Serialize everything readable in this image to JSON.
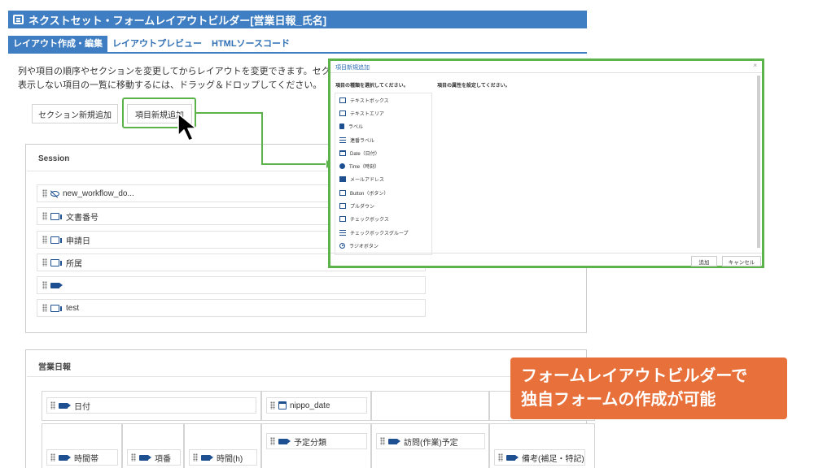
{
  "app": {
    "title": "ネクストセット・フォームレイアウトビルダー[営業日報_氏名]"
  },
  "tabs": [
    {
      "label": "レイアウト作成・編集",
      "active": true
    },
    {
      "label": "レイアウトプレビュー",
      "active": false
    },
    {
      "label": "HTMLソースコード",
      "active": false
    }
  ],
  "description": {
    "line1": "列や項目の順序やセクションを変更してからレイアウトを変更できます。セクションの見",
    "line2": "表示しない項目の一覧に移動するには、ドラッグ＆ドロップしてください。"
  },
  "toolbar": {
    "add_section": "セクション新規追加",
    "add_item": "項目新規追加"
  },
  "session_panel": {
    "title": "Session",
    "fields": [
      {
        "label": "new_workflow_do...",
        "icon": "eye-off-icon"
      },
      {
        "label": "文書番号",
        "icon": "text-field-icon"
      },
      {
        "label": "申請日",
        "icon": "text-field-icon"
      },
      {
        "label": "所属",
        "icon": "text-field-icon"
      },
      {
        "label": "",
        "icon": "label-icon"
      },
      {
        "label": "test",
        "icon": "text-field-icon"
      }
    ]
  },
  "nippo_panel": {
    "title": "営業日報",
    "fields": {
      "date": "日付",
      "nippo_date": "nippo_date",
      "plan_category": "予定分類",
      "visit_plan": "訪問(作業)予定",
      "time_slot": "時間帯",
      "item_no": "項番",
      "hours": "時間(h)",
      "remarks": "備考(補足・特記)"
    }
  },
  "dialog": {
    "title": "項目新規追加",
    "close": "×",
    "left_header": "項目の種類を選択してください。",
    "right_header": "項目の属性を設定してください。",
    "types": [
      {
        "label": "テキストボックス",
        "icon": "textbox-icon"
      },
      {
        "label": "テキストエリア",
        "icon": "textarea-icon"
      },
      {
        "label": "ラベル",
        "icon": "label-icon"
      },
      {
        "label": "連番ラベル",
        "icon": "numbered-label-icon"
      },
      {
        "label": "Date（日付）",
        "icon": "calendar-icon"
      },
      {
        "label": "Time（時刻）",
        "icon": "clock-icon"
      },
      {
        "label": "メールアドレス",
        "icon": "mail-icon"
      },
      {
        "label": "Button（ボタン）",
        "icon": "button-icon"
      },
      {
        "label": "プルダウン",
        "icon": "dropdown-icon"
      },
      {
        "label": "チェックボックス",
        "icon": "checkbox-icon"
      },
      {
        "label": "チェックボックスグループ",
        "icon": "checkbox-group-icon"
      },
      {
        "label": "ラジオボタン",
        "icon": "radio-icon"
      }
    ],
    "add": "追加",
    "cancel": "キャンセル"
  },
  "callout": {
    "line1": "フォームレイアウトビルダーで",
    "line2": "独自フォームの作成が可能"
  },
  "colors": {
    "header_blue": "#3f7ec2",
    "highlight_green": "#5cb34a",
    "callout_orange": "#e8703a",
    "icon_navy": "#1d4f91"
  }
}
